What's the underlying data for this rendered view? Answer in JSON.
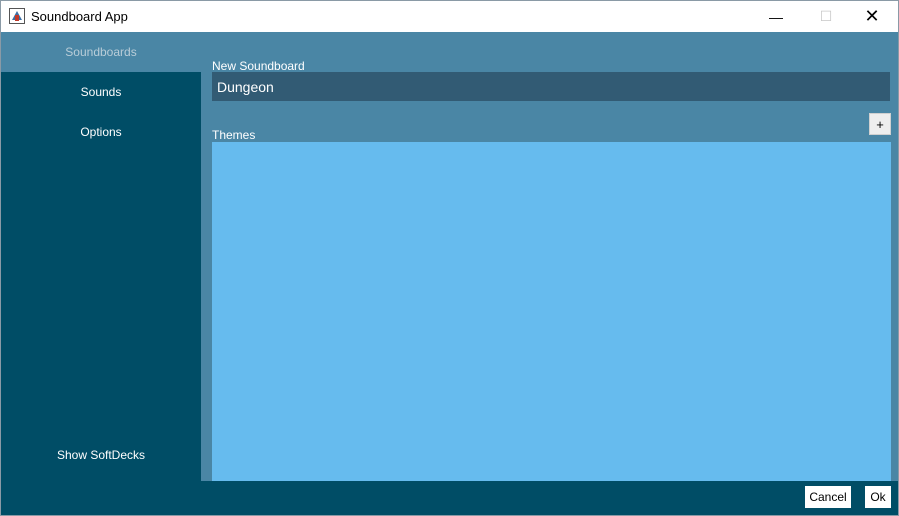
{
  "window": {
    "title": "Soundboard App",
    "controls": {
      "minimize": "—",
      "maximize": "☐",
      "close": "✕"
    }
  },
  "sidebar": {
    "items": [
      {
        "label": "Soundboards",
        "active": true
      },
      {
        "label": "Sounds",
        "active": false
      },
      {
        "label": "Options",
        "active": false
      }
    ],
    "show_softdecks": "Show SoftDecks"
  },
  "form": {
    "name_label": "New Soundboard",
    "name_value": "Dungeon",
    "themes_label": "Themes",
    "add_label": "+",
    "themes": []
  },
  "footer": {
    "cancel_label": "Cancel",
    "ok_label": "Ok"
  },
  "colors": {
    "main_bg": "#4a86a5",
    "sidebar_bg": "#004d66",
    "input_bg": "#325b74",
    "list_bg": "#66bbee"
  }
}
